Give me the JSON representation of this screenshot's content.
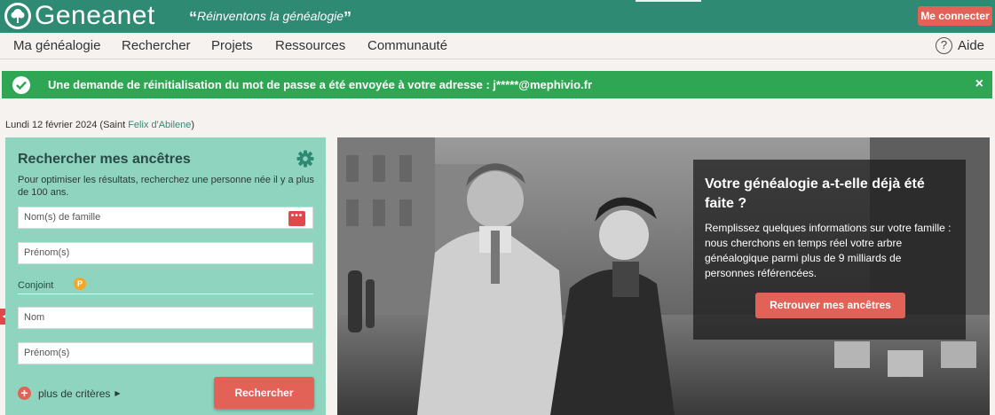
{
  "header": {
    "logo_text": "Geneanet",
    "tagline": "Réinventons la généalogie",
    "tagline_open_quote": "“",
    "tagline_close_quote": "”",
    "login_label": "Me connecter"
  },
  "nav": {
    "items": [
      {
        "label": "Ma généalogie"
      },
      {
        "label": "Rechercher"
      },
      {
        "label": "Projets"
      },
      {
        "label": "Ressources"
      },
      {
        "label": "Communauté"
      }
    ],
    "help_icon": "question-circle-icon",
    "help_label": "Aide"
  },
  "alert": {
    "text": "Une demande de réinitialisation du mot de passe a été envoyée à votre adresse : j*****@mephivio.fr",
    "close_glyph": "×",
    "color": "#2fa653"
  },
  "dateline": {
    "prefix": "Lundi 12 février 2024 (Saint ",
    "saint_link": "Felix d'Abilene",
    "suffix": ")"
  },
  "search_panel": {
    "title": "Rechercher mes ancêtres",
    "description": "Pour optimiser les résultats, recherchez une personne née il y a plus de 100 ans.",
    "lastname_placeholder": "Nom(s) de famille",
    "lastname_options_glyph": "•••",
    "firstname_placeholder": "Prénom(s)",
    "spouse_label": "Conjoint",
    "premium_badge": "P",
    "spouse_lastname_placeholder": "Nom",
    "spouse_firstname_placeholder": "Prénom(s)",
    "more_criteria_label": "plus de critères",
    "more_criteria_arrow": "▶",
    "search_button": "Rechercher",
    "side_tab_glyph": "◂"
  },
  "hero": {
    "title": "Votre généalogie a-t-elle déjà été faite ?",
    "text": "Remplissez quelques informations sur votre famille : nous cherchons en temps réel votre arbre généalogique parmi plus de 9 milliards de personnes référencées.",
    "button": "Retrouver mes ancêtres"
  },
  "colors": {
    "brand_green": "#2e8a73",
    "panel_mint": "#8fd4bf",
    "accent_red": "#e26258"
  }
}
